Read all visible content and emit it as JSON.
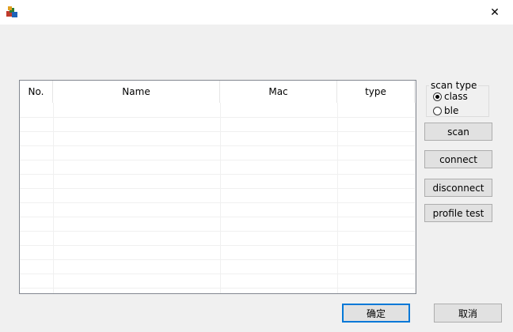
{
  "window": {
    "close_glyph": "✕"
  },
  "scan_list": {
    "columns": [
      "No.",
      "Name",
      "Mac",
      "type"
    ],
    "rows": []
  },
  "scan_type": {
    "title": "scan type",
    "options": [
      {
        "label": "class",
        "selected": true
      },
      {
        "label": "ble",
        "selected": false
      }
    ]
  },
  "actions": {
    "scan": "scan",
    "connect": "connect",
    "disconnect": "disconnect",
    "profile_test": "profile test"
  },
  "dialog": {
    "ok": "确定",
    "cancel": "取消"
  }
}
